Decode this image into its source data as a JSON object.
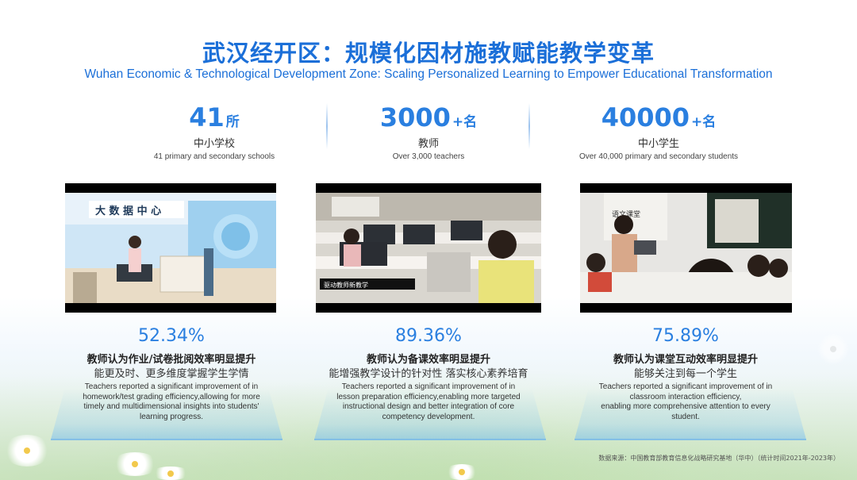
{
  "header": {
    "title": "武汉经开区：规模化因材施教赋能教学变革",
    "subtitle": "Wuhan Economic & Technological Development Zone: Scaling Personalized Learning to Empower Educational Transformation"
  },
  "stats": [
    {
      "number": "41",
      "unit": "所",
      "cn": "中小学校",
      "en": "41 primary and secondary schools"
    },
    {
      "number": "3000",
      "unit": "+名",
      "cn": "教师",
      "en": "Over 3,000  teachers"
    },
    {
      "number": "40000",
      "unit": "+名",
      "cn": "中小学生",
      "en": "Over 40,000 primary and secondary students"
    }
  ],
  "photos": {
    "p1_sign": "大 数 据 中 心",
    "p2_caption": "驱动教师新教学",
    "p3_board": "语文课堂"
  },
  "findings": [
    {
      "percent": "52.34%",
      "cn_title": "教师认为作业/试卷批阅效率明显提升",
      "cn_sub": "能更及时、更多维度掌握学生学情",
      "en_lines": [
        "Teachers reported a significant improvement  of  in",
        "homework/test grading efficiency,allowing for more",
        "timely and multidimensional insights into students'",
        "learning progress."
      ]
    },
    {
      "percent": "89.36%",
      "cn_title": "教师认为备课效率明显提升",
      "cn_sub": "能增强教学设计的针对性  落实核心素养培育",
      "en_lines": [
        "Teachers reported a significant improvement of in",
        "lesson preparation efficiency,enabling more targeted",
        "instructional design and better integration of core",
        "competency development."
      ]
    },
    {
      "percent": "75.89%",
      "cn_title": "教师认为课堂互动效率明显提升",
      "cn_sub": "能够关注到每一个学生",
      "en_lines": [
        "Teachers reported a significant improvement  of  in",
        "classroom interaction efficiency,",
        "enabling more comprehensive attention to every",
        "student."
      ]
    }
  ],
  "source": "数据来源：中国教育部教育信息化战略研究基地（华中）（统计时间2021年-2023年）",
  "colors": {
    "accent": "#1b6fd8",
    "number": "#2a7fe0"
  }
}
